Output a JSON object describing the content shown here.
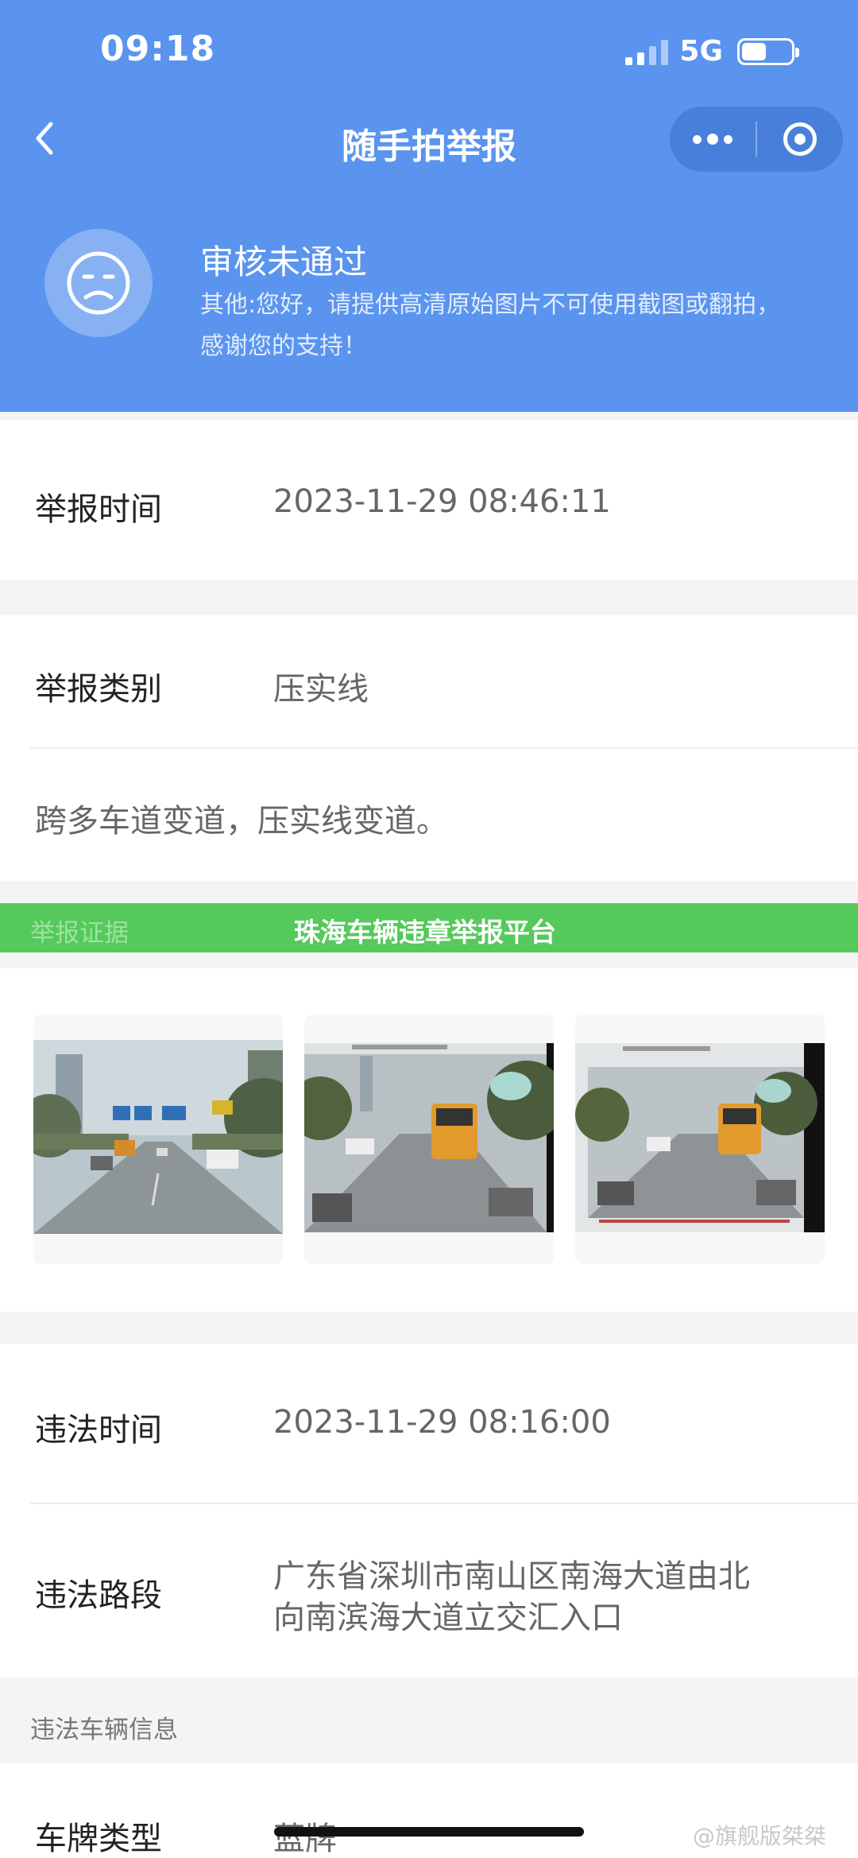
{
  "status_bar": {
    "time": "09:18",
    "network": "5G",
    "battery_level": 0.5
  },
  "nav": {
    "title": "随手拍举报",
    "back_icon": "chevron-left-icon",
    "more_icon": "more-dots-icon",
    "close_icon": "target-circle-icon"
  },
  "review": {
    "status": "审核未通过",
    "reason": "其他:您好，请提供高清原始图片不可使用截图或翻拍，感谢您的支持！",
    "icon": "sad-face-icon"
  },
  "report": {
    "time_label": "举报时间",
    "time_value": "2023-11-29 08:46:11",
    "category_label": "举报类别",
    "category_value": "压实线",
    "description": "跨多车道变道，压实线变道。"
  },
  "evidence": {
    "label": "举报证据",
    "banner": "珠海车辆违章举报平台",
    "photos": [
      "photo-road-signs",
      "photo-bus-screen-1",
      "photo-bus-screen-2"
    ]
  },
  "violation": {
    "time_label": "违法时间",
    "time_value": "2023-11-29 08:16:00",
    "place_label": "违法路段",
    "place_value_line1": "广东省深圳市南山区南海大道由北",
    "place_value_line2": "向南滨海大道立交汇入口"
  },
  "vehicle": {
    "section_title": "违法车辆信息",
    "plate_type_label": "车牌类型",
    "plate_type_value": "蓝牌"
  },
  "watermark": "@旗舰版桀桀",
  "colors": {
    "header": "#5a94ef",
    "banner": "#55c95b"
  }
}
